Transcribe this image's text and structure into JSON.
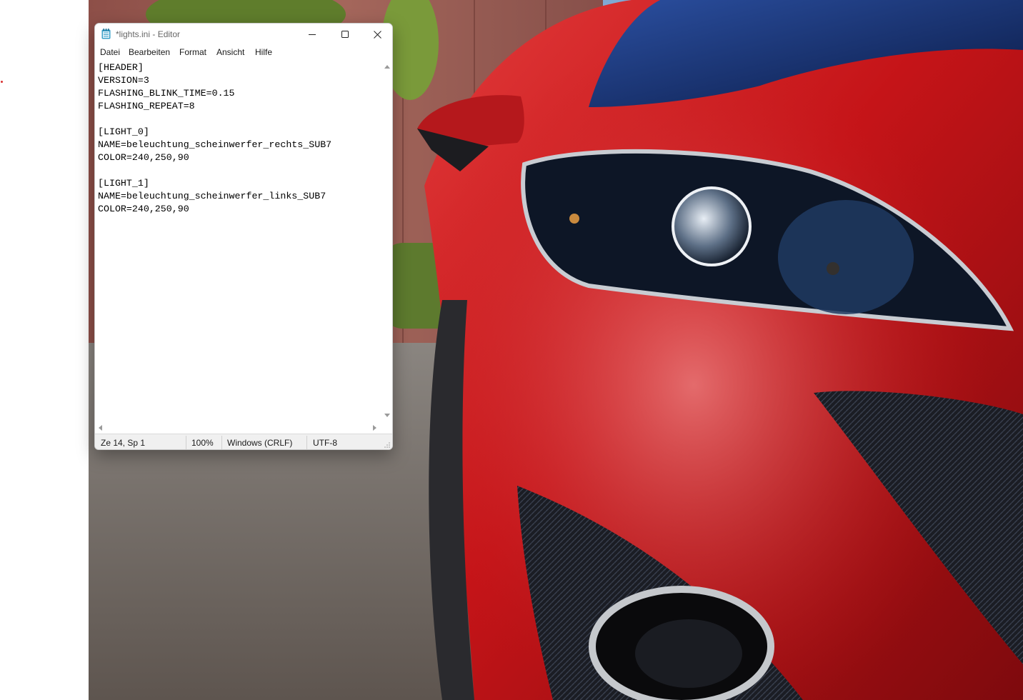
{
  "window": {
    "title": "*lights.ini - Editor",
    "controls": {
      "minimize": "minimize",
      "maximize": "maximize",
      "close": "close"
    }
  },
  "menu": [
    "Datei",
    "Bearbeiten",
    "Format",
    "Ansicht",
    "Hilfe"
  ],
  "editor": {
    "content": "[HEADER]\nVERSION=3\nFLASHING_BLINK_TIME=0.15\nFLASHING_REPEAT=8\n\n[LIGHT_0]\nNAME=beleuchtung_scheinwerfer_rechts_SUB7\nCOLOR=240,250,90\n\n[LIGHT_1]\nNAME=beleuchtung_scheinwerfer_links_SUB7\nCOLOR=240,250,90"
  },
  "status": {
    "position": "Ze 14, Sp 1",
    "zoom": "100%",
    "line_ending": "Windows (CRLF)",
    "encoding": "UTF-8"
  },
  "icons": {
    "app": "notepad-icon",
    "resize": "resize-grip-icon"
  },
  "colors": {
    "car_red": "#c41014",
    "building": "#9a5a52",
    "asphalt": "#6f6660",
    "hedge": "#5d7a2e"
  }
}
